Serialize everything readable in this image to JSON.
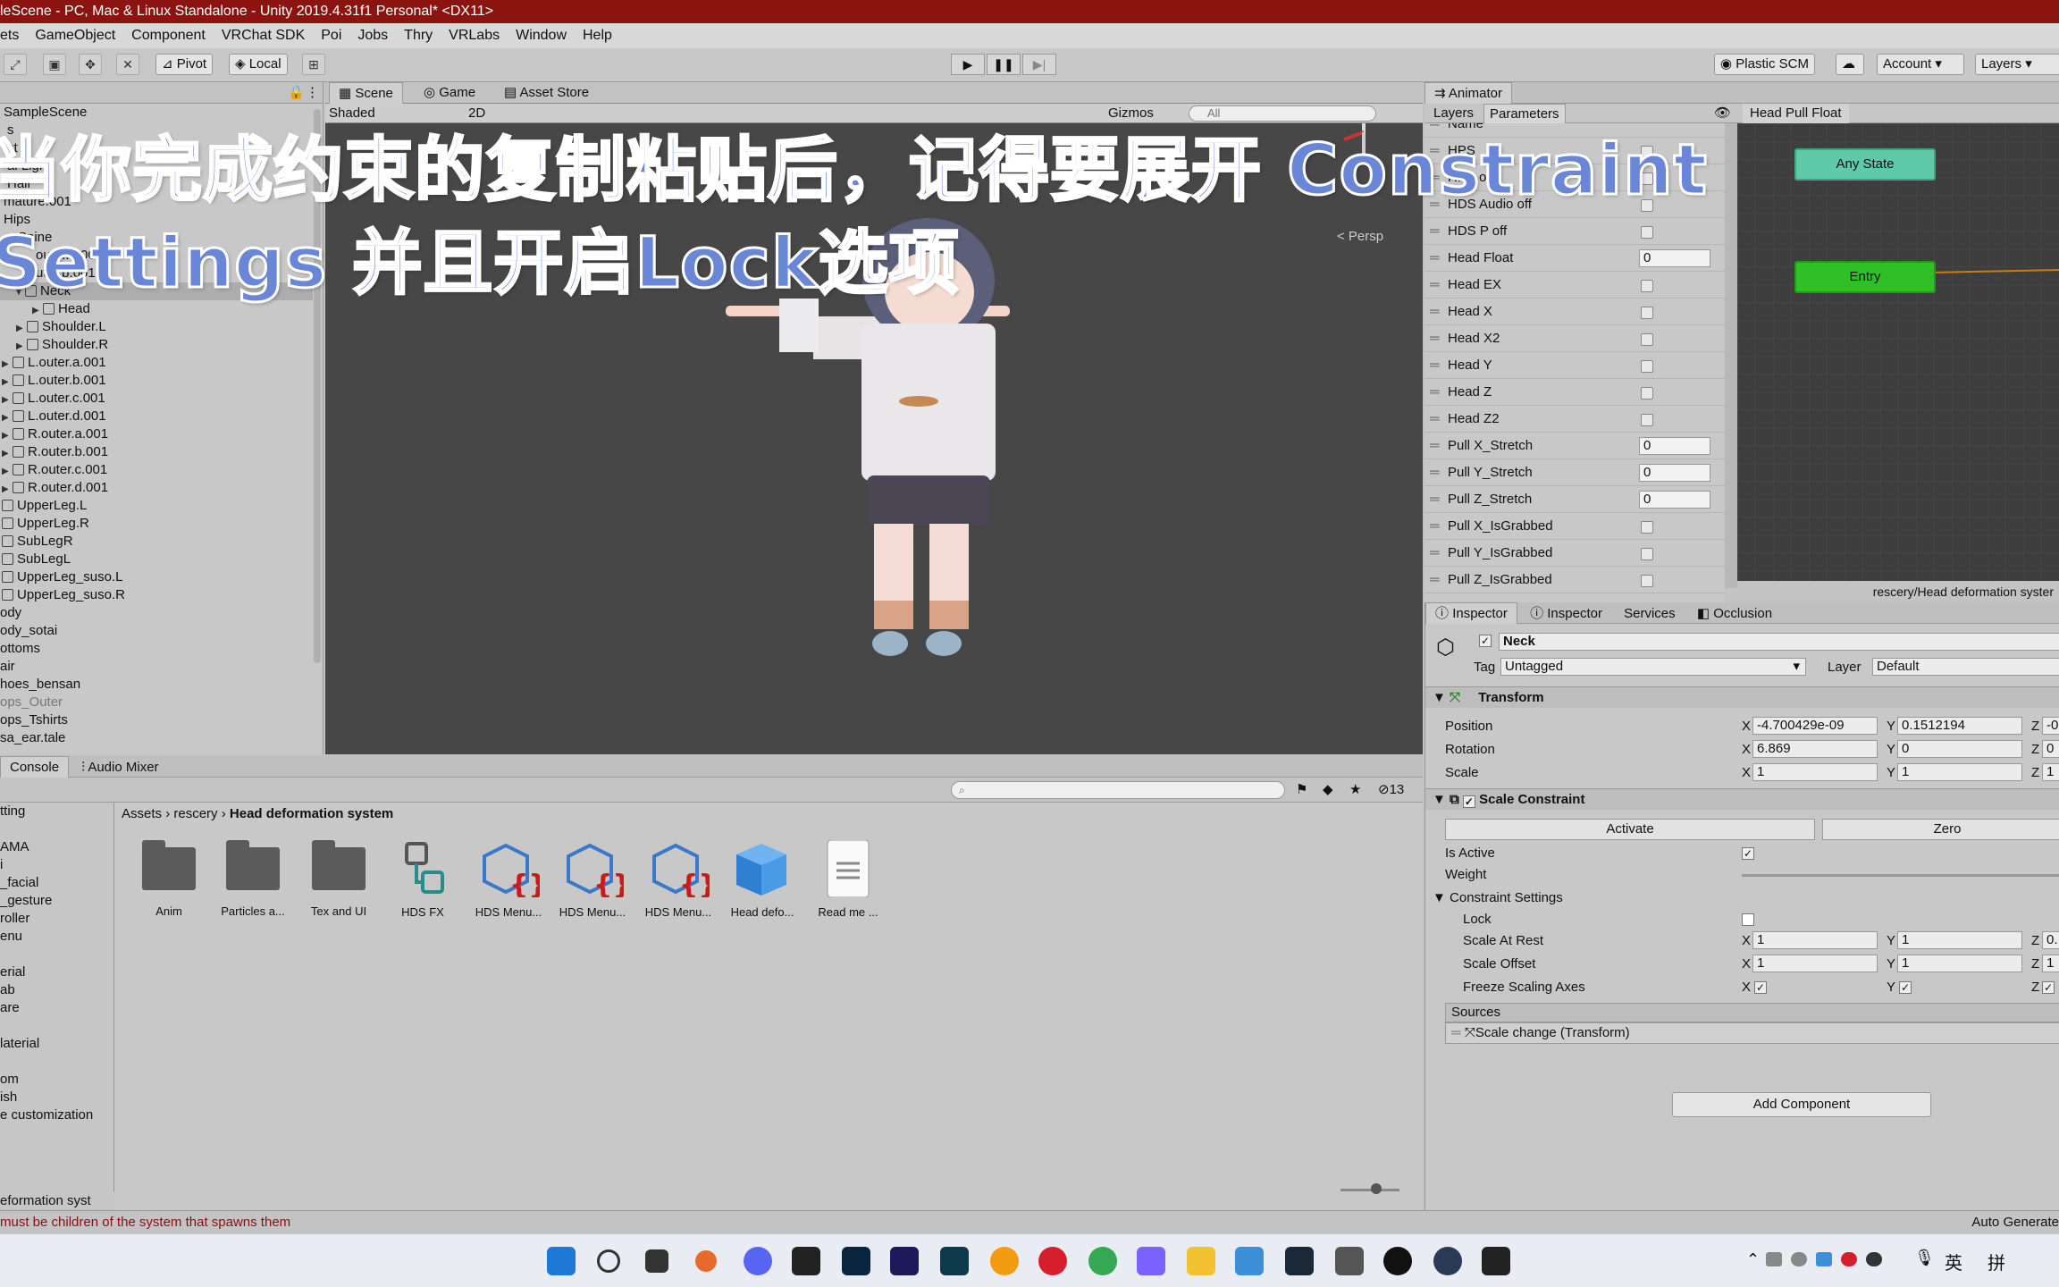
{
  "titlebar": {
    "title": "leScene - PC, Mac & Linux Standalone - Unity 2019.4.31f1 Personal* <DX11>"
  },
  "menu": [
    "ets",
    "GameObject",
    "Component",
    "VRChat SDK",
    "Poi",
    "Jobs",
    "Thry",
    "VRLabs",
    "Window",
    "Help"
  ],
  "toolbar": {
    "pivot": "Pivot",
    "local": "Local",
    "plastic": "Plastic SCM",
    "account": "Account",
    "layers": "Layers"
  },
  "hierarchy": {
    "rows": [
      "SampleScene",
      "s",
      "st",
      "al Light",
      "Hair",
      "mature.001",
      "Hips",
      "Spine",
      "outer.a.001",
      "uter.b.001",
      "Neck",
      "Head",
      "Shoulder.L",
      "Shoulder.R",
      "L.outer.a.001",
      "L.outer.b.001",
      "L.outer.c.001",
      "L.outer.d.001",
      "R.outer.a.001",
      "R.outer.b.001",
      "R.outer.c.001",
      "R.outer.d.001",
      "UpperLeg.L",
      "UpperLeg.R",
      "SubLegR",
      "SubLegL",
      "UpperLeg_suso.L",
      "UpperLeg_suso.R",
      "ody",
      "ody_sotai",
      "ottoms",
      "air",
      "hoes_bensan",
      "ops_Outer",
      "ops_Tshirts",
      "sa_ear.tale"
    ]
  },
  "scene": {
    "tabs": [
      "Scene",
      "Game",
      "Asset Store"
    ],
    "shading": "Shaded",
    "mode2d": "2D",
    "gizmos": "Gizmos",
    "search": "All",
    "persp": "< Persp"
  },
  "animator": {
    "title": "Animator",
    "tabs": [
      "Layers",
      "Parameters"
    ],
    "breadcrumb": "Head Pull Float",
    "any_state": "Any State",
    "entry": "Entry",
    "path": "rescery/Head deformation syster",
    "params": [
      {
        "name": "Name",
        "type": "label",
        "value": ""
      },
      {
        "name": "HPS",
        "type": "bool",
        "value": ""
      },
      {
        "name": "HPS on",
        "type": "bool",
        "value": ""
      },
      {
        "name": "HDS Audio off",
        "type": "bool",
        "value": ""
      },
      {
        "name": "HDS P off",
        "type": "bool",
        "value": ""
      },
      {
        "name": "Head Float",
        "type": "float",
        "value": "0"
      },
      {
        "name": "Head EX",
        "type": "bool",
        "value": ""
      },
      {
        "name": "Head X",
        "type": "bool",
        "value": ""
      },
      {
        "name": "Head X2",
        "type": "bool",
        "value": ""
      },
      {
        "name": "Head Y",
        "type": "bool",
        "value": ""
      },
      {
        "name": "Head Z",
        "type": "bool",
        "value": ""
      },
      {
        "name": "Head Z2",
        "type": "bool",
        "value": ""
      },
      {
        "name": "Pull X_Stretch",
        "type": "float",
        "value": "0"
      },
      {
        "name": "Pull Y_Stretch",
        "type": "float",
        "value": "0"
      },
      {
        "name": "Pull Z_Stretch",
        "type": "float",
        "value": "0"
      },
      {
        "name": "Pull X_IsGrabbed",
        "type": "bool",
        "value": ""
      },
      {
        "name": "Pull Y_IsGrabbed",
        "type": "bool",
        "value": ""
      },
      {
        "name": "Pull Z_IsGrabbed",
        "type": "bool",
        "value": ""
      }
    ]
  },
  "inspector": {
    "tabs": [
      "Inspector",
      "Inspector",
      "Services",
      "Occlusion"
    ],
    "object_name": "Neck",
    "tag_label": "Tag",
    "tag": "Untagged",
    "layer_label": "Layer",
    "layer": "Default",
    "transform": {
      "title": "Transform",
      "position_label": "Position",
      "px": "-4.700429e-09",
      "py": "0.1512194",
      "pz": "-0",
      "rotation_label": "Rotation",
      "rx": "6.869",
      "ry": "0",
      "rz": "0",
      "scale_label": "Scale",
      "sx": "1",
      "sy": "1",
      "sz": "1"
    },
    "constraint": {
      "title": "Scale Constraint",
      "activate": "Activate",
      "zero": "Zero",
      "is_active": "Is Active",
      "weight": "Weight",
      "settings": "Constraint Settings",
      "lock": "Lock",
      "scale_at_rest": "Scale At Rest",
      "rest_x": "1",
      "rest_y": "1",
      "rest_z": "0.",
      "scale_offset": "Scale Offset",
      "off_x": "1",
      "off_y": "1",
      "off_z": "1",
      "freeze": "Freeze Scaling Axes",
      "sources": "Sources",
      "source_item": "Scale change (Transform)"
    },
    "add_component": "Add Component",
    "axis_x": "X",
    "axis_y": "Y",
    "axis_z": "Z"
  },
  "project": {
    "tabs": [
      "Console",
      "Audio Mixer"
    ],
    "breadcrumb": [
      "Assets",
      "rescery",
      "Head deformation system"
    ],
    "count": "13",
    "folders": [
      "tting",
      "",
      "AMA",
      "i",
      "_facial",
      "_gesture",
      "roller",
      "enu",
      "",
      "erial",
      "ab",
      "are",
      "",
      "laterial",
      "",
      "om",
      "ish",
      "e customization"
    ],
    "folder_bottom": "eformation syst",
    "assets": [
      {
        "label": "Anim",
        "kind": "folder"
      },
      {
        "label": "Particles a...",
        "kind": "folder"
      },
      {
        "label": "Tex and UI",
        "kind": "folder"
      },
      {
        "label": "HDS FX",
        "kind": "animator"
      },
      {
        "label": "HDS Menu...",
        "kind": "script"
      },
      {
        "label": "HDS Menu...",
        "kind": "script"
      },
      {
        "label": "HDS Menu...",
        "kind": "script"
      },
      {
        "label": "Head defo...",
        "kind": "prefab"
      },
      {
        "label": "Read me ...",
        "kind": "text"
      }
    ]
  },
  "status": {
    "message": "must be children of the system that spawns them",
    "right": "Auto Generate"
  },
  "overlay": {
    "line1": "当你完成约束的复制粘贴后，记得要展开 Constraint",
    "line2": "Settings 并且开启Lock选项"
  },
  "taskbar": {
    "ime1": "英",
    "ime2": "拼"
  }
}
